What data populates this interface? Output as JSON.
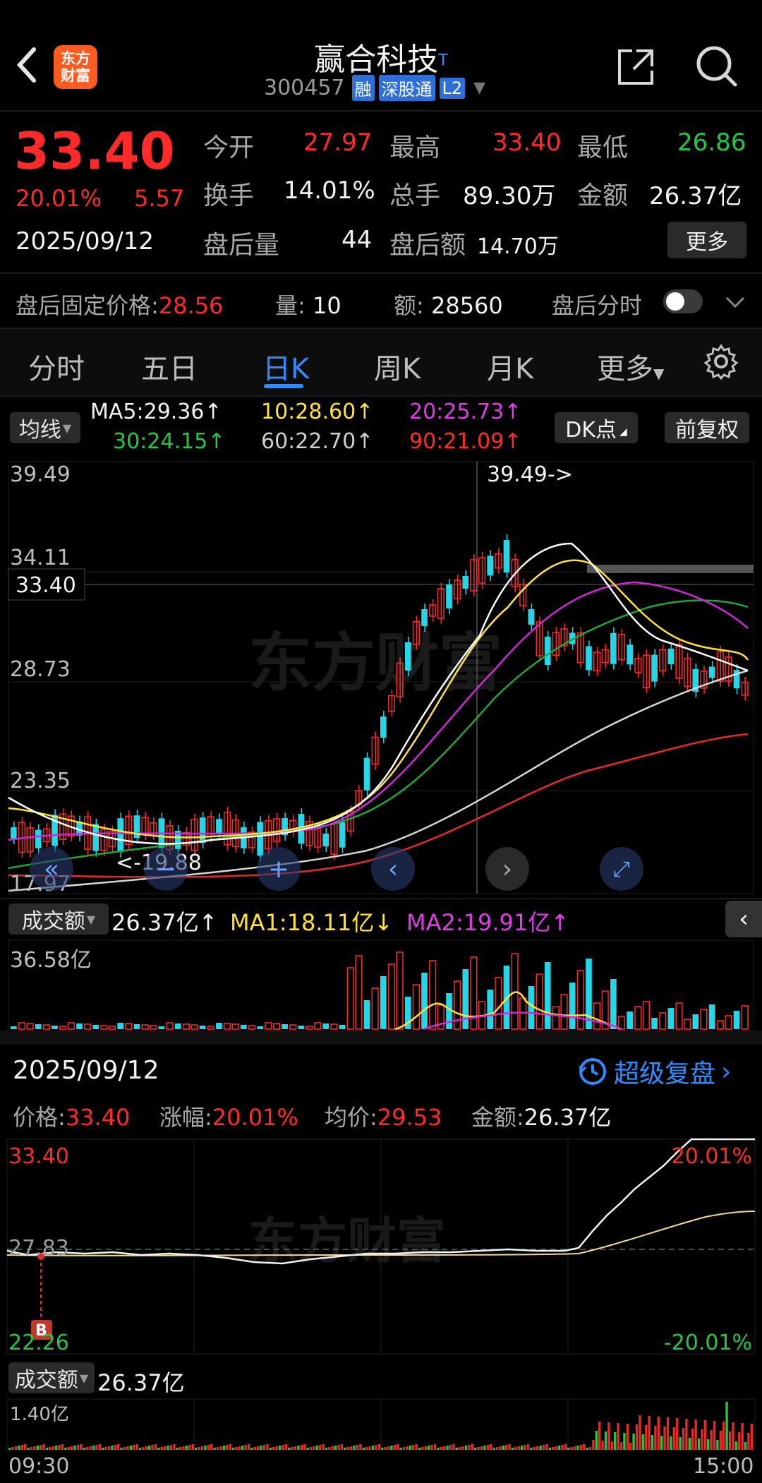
{
  "header": {
    "logo_text": "东方财富",
    "stock_name": "赢合科技",
    "stock_name_sup": "T",
    "stock_code": "300457",
    "tags": [
      "融",
      "深股通",
      "L2"
    ]
  },
  "quote": {
    "price": "33.40",
    "change_pct": "20.01%",
    "change_amt": "5.57",
    "date": "2025/09/12",
    "open_label": "今开",
    "open": "27.97",
    "high_label": "最高",
    "high": "33.40",
    "low_label": "最低",
    "low": "26.86",
    "turnover_label": "换手",
    "turnover": "14.01%",
    "volume_label": "总手",
    "volume": "89.30万",
    "amount_label": "金额",
    "amount": "26.37亿",
    "after_vol_label": "盘后量",
    "after_vol": "44",
    "after_amt_label": "盘后额",
    "after_amt": "14.70万",
    "more_label": "更多"
  },
  "afterhours": {
    "fixed_price_label": "盘后固定价格:",
    "fixed_price": "28.56",
    "qty_label": "量:",
    "qty": "10",
    "amt_label": "额:",
    "amt": "28560",
    "timeshare_label": "盘后分时"
  },
  "tabs": [
    "分时",
    "五日",
    "日K",
    "周K",
    "月K",
    "更多"
  ],
  "ma": {
    "selector": "均线",
    "ma5": "MA5:29.36",
    "ma10": "10:28.60",
    "ma20": "20:25.73",
    "ma30": "30:24.15",
    "ma60": "60:22.70",
    "ma90": "90:21.09",
    "dk_label": "DK点",
    "adjust_label": "前复权"
  },
  "kline": {
    "y_top": "39.49",
    "y_2": "34.11",
    "y_current": "33.40",
    "y_3": "28.73",
    "y_4": "23.35",
    "y_bottom": "17.97",
    "high_marker": "39.49->",
    "low_marker": "<-19.88"
  },
  "volume_panel": {
    "selector": "成交额",
    "value": "26.37亿",
    "ma1": "MA1:18.11亿",
    "ma2": "MA2:19.91亿",
    "y_top": "36.58亿"
  },
  "intraday": {
    "date": "2025/09/12",
    "replay_label": "超级复盘",
    "price_label": "价格:",
    "price": "33.40",
    "pct_label": "涨幅:",
    "pct": "20.01%",
    "avg_label": "均价:",
    "avg": "29.53",
    "amount_label": "金额:",
    "amount": "26.37亿",
    "y_top": "33.40",
    "y_mid": "27.83",
    "y_bottom": "22.26",
    "pct_top": "20.01%",
    "pct_bottom": "-20.01%",
    "b_marker": "B"
  },
  "intraday_volume": {
    "selector": "成交额",
    "value": "26.37亿",
    "y_top": "1.40亿",
    "time_start": "09:30",
    "time_end": "15:00"
  }
}
